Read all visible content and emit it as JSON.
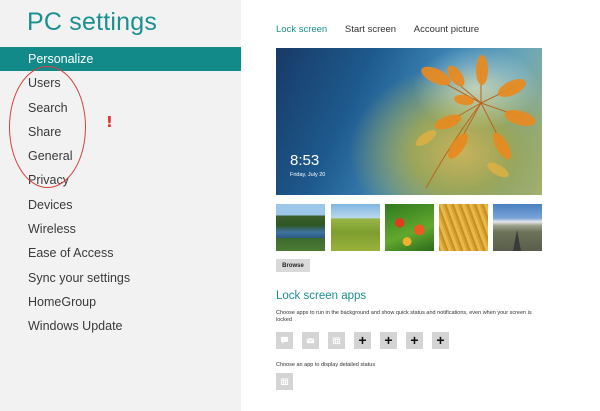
{
  "title": "PC settings",
  "nav": {
    "items": [
      {
        "label": "Personalize"
      },
      {
        "label": "Users"
      },
      {
        "label": "Search"
      },
      {
        "label": "Share"
      },
      {
        "label": "General"
      },
      {
        "label": "Privacy"
      },
      {
        "label": "Devices"
      },
      {
        "label": "Wireless"
      },
      {
        "label": "Ease of Access"
      },
      {
        "label": "Sync your settings"
      },
      {
        "label": "HomeGroup"
      },
      {
        "label": "Windows Update"
      }
    ],
    "selected_index": 0
  },
  "annotation": {
    "mark": "!"
  },
  "tabs": [
    {
      "label": "Lock screen",
      "active": true
    },
    {
      "label": "Start screen",
      "active": false
    },
    {
      "label": "Account picture",
      "active": false
    }
  ],
  "lock_screen": {
    "time": "8:53",
    "date": "Friday, July 20"
  },
  "thumbnails": [
    "autumn-lake",
    "green-hills",
    "red-flowers",
    "golden-grass",
    "mountain-road"
  ],
  "browse_label": "Browse",
  "apps_section": {
    "title": "Lock screen apps",
    "description": "Choose apps to run in the background and show quick status and notifications, even when your screen is locked",
    "app_icons": [
      "messaging-icon",
      "mail-icon",
      "calendar-icon"
    ],
    "empty_slot_label": "+",
    "empty_slot_count": 4,
    "detail_description": "Choose an app to display detailed status",
    "detail_icon": "calendar-icon"
  },
  "colors": {
    "accent": "#1c8f8f",
    "selected_bg": "#138a8a",
    "sidebar_bg": "#f2f2f2",
    "annotation": "#d6403d"
  }
}
